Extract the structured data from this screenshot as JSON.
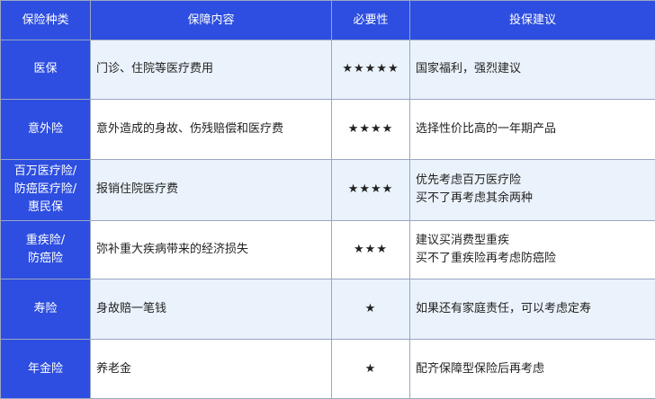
{
  "header": {
    "type": "保险种类",
    "content": "保障内容",
    "necessity": "必要性",
    "advice": "投保建议"
  },
  "rows": [
    {
      "type": [
        "医保"
      ],
      "content": "门诊、住院等医疗费用",
      "necessity": "★★★★★",
      "advice": [
        "国家福利，强烈建议"
      ]
    },
    {
      "type": [
        "意外险"
      ],
      "content": "意外造成的身故、伤残赔偿和医疗费",
      "necessity": "★★★★",
      "advice": [
        "选择性价比高的一年期产品"
      ]
    },
    {
      "type": [
        "百万医疗险/",
        "防癌医疗险/",
        "惠民保"
      ],
      "content": "报销住院医疗费",
      "necessity": "★★★★",
      "advice": [
        "优先考虑百万医疗险",
        "买不了再考虑其余两种"
      ]
    },
    {
      "type": [
        "重疾险/",
        "防癌险"
      ],
      "content": "弥补重大疾病带来的经济损失",
      "necessity": "★★★",
      "advice": [
        "建议买消费型重疾",
        "买不了重疾险再考虑防癌险"
      ]
    },
    {
      "type": [
        "寿险"
      ],
      "content": "身故赔一笔钱",
      "necessity": "★",
      "advice": [
        "如果还有家庭责任，可以考虑定寿"
      ]
    },
    {
      "type": [
        "年金险"
      ],
      "content": "养老金",
      "necessity": "★",
      "advice": [
        "配齐保障型保险后再考虑"
      ]
    }
  ]
}
